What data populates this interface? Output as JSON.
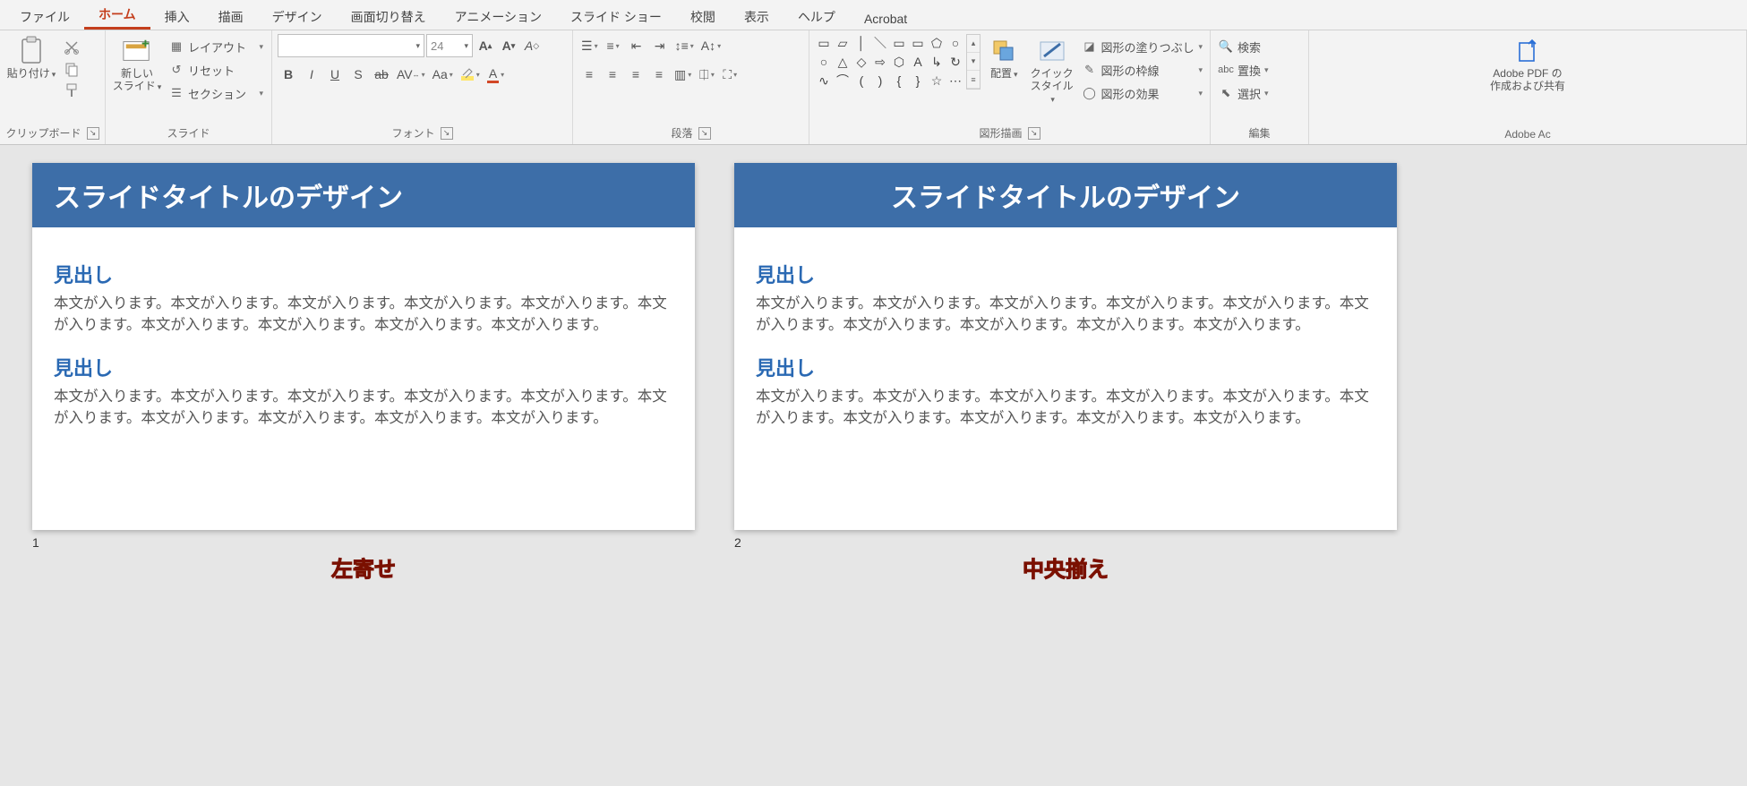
{
  "tabs": {
    "file": "ファイル",
    "home": "ホーム",
    "insert": "挿入",
    "draw": "描画",
    "design": "デザイン",
    "transition": "画面切り替え",
    "animation": "アニメーション",
    "slideshow": "スライド ショー",
    "review": "校閲",
    "view": "表示",
    "help": "ヘルプ",
    "acrobat": "Acrobat"
  },
  "groups": {
    "clipboard": {
      "label": "クリップボード",
      "paste": "貼り付け"
    },
    "slides": {
      "label": "スライド",
      "new_slide": "新しい\nスライド",
      "layout": "レイアウト",
      "reset": "リセット",
      "section": "セクション"
    },
    "font": {
      "label": "フォント",
      "font_name_placeholder": "",
      "font_size": "24"
    },
    "paragraph": {
      "label": "段落"
    },
    "drawing": {
      "label": "図形描画",
      "arrange": "配置",
      "quick_styles": "クイック\nスタイル",
      "shape_fill": "図形の塗りつぶし",
      "shape_outline": "図形の枠線",
      "shape_effects": "図形の効果"
    },
    "editing": {
      "label": "編集",
      "find": "検索",
      "replace": "置換",
      "select": "選択"
    },
    "adobe": {
      "label": "Adobe Ac",
      "pdf": "Adobe PDF の\n作成および共有"
    }
  },
  "slides": {
    "s1": {
      "number": "1",
      "title": "スライドタイトルのデザイン",
      "h1": "見出し",
      "b1": "本文が入ります。本文が入ります。本文が入ります。本文が入ります。本文が入ります。本文が入ります。本文が入ります。本文が入ります。本文が入ります。本文が入ります。",
      "h2": "見出し",
      "b2": "本文が入ります。本文が入ります。本文が入ります。本文が入ります。本文が入ります。本文が入ります。本文が入ります。本文が入ります。本文が入ります。本文が入ります。",
      "caption": "左寄せ"
    },
    "s2": {
      "number": "2",
      "title": "スライドタイトルのデザイン",
      "h1": "見出し",
      "b1": "本文が入ります。本文が入ります。本文が入ります。本文が入ります。本文が入ります。本文が入ります。本文が入ります。本文が入ります。本文が入ります。本文が入ります。",
      "h2": "見出し",
      "b2": "本文が入ります。本文が入ります。本文が入ります。本文が入ります。本文が入ります。本文が入ります。本文が入ります。本文が入ります。本文が入ります。本文が入ります。",
      "caption": "中央揃え"
    }
  }
}
